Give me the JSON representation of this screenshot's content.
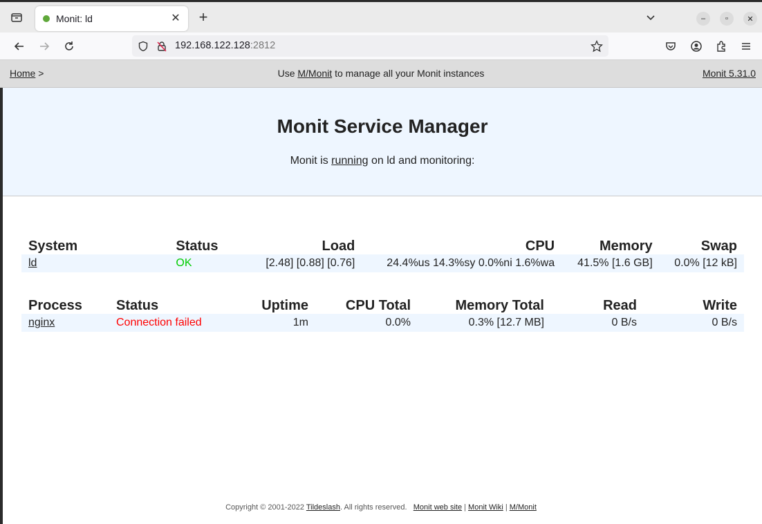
{
  "browser": {
    "tab": {
      "title": "Monit: ld"
    },
    "url": {
      "host": "192.168.122.128",
      "port": ":2812"
    }
  },
  "monitbar": {
    "home": "Home",
    "home_sep": ">",
    "center_prefix": "Use",
    "center_link": "M/Monit",
    "center_suffix": "to manage all your Monit instances",
    "version": "Monit 5.31.0"
  },
  "hero": {
    "title": "Monit Service Manager",
    "status_prefix": "Monit is",
    "status_link": "running",
    "status_suffix": "on ld and monitoring:"
  },
  "system_table": {
    "headers": {
      "system": "System",
      "status": "Status",
      "load": "Load",
      "cpu": "CPU",
      "memory": "Memory",
      "swap": "Swap"
    },
    "row": {
      "system": "ld",
      "status": "OK",
      "load": "[2.48] [0.88] [0.76]",
      "cpu": "24.4%us 14.3%sy 0.0%ni 1.6%wa",
      "memory": "41.5% [1.6 GB]",
      "swap": "0.0% [12 kB]"
    }
  },
  "process_table": {
    "headers": {
      "process": "Process",
      "status": "Status",
      "uptime": "Uptime",
      "cpu_total": "CPU Total",
      "memory_total": "Memory Total",
      "read": "Read",
      "write": "Write"
    },
    "row": {
      "process": "nginx",
      "status": "Connection failed",
      "uptime": "1m",
      "cpu_total": "0.0%",
      "memory_total": "0.3% [12.7 MB]",
      "read": "0 B/s",
      "write": "0 B/s"
    }
  },
  "footer": {
    "copyright": "Copyright © 2001-2022",
    "company": "Tildeslash",
    "rights": ". All rights reserved.",
    "link_website": "Monit web site",
    "link_wiki": "Monit Wiki",
    "link_mmonit": "M/Monit",
    "sep": "|"
  },
  "colors": {
    "ok": "#00cc00",
    "fail": "#ff0000",
    "hero_bg": "#eef6ff",
    "bar_bg": "#dddddd"
  },
  "icons": [
    "tab-list-icon",
    "close-icon",
    "plus-icon",
    "chevron-down-icon",
    "minimize-icon",
    "restore-icon",
    "back-icon",
    "forward-icon",
    "reload-icon",
    "shield-icon",
    "insecure-lock-icon",
    "star-icon",
    "pocket-icon",
    "account-icon",
    "extensions-icon",
    "menu-icon"
  ]
}
